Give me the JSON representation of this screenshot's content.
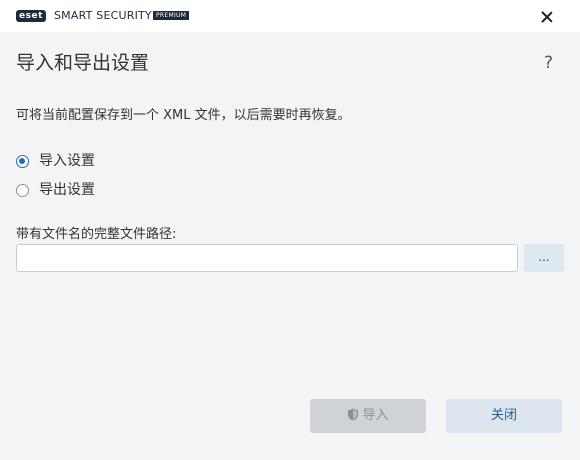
{
  "titlebar": {
    "logo": "eset",
    "product": "SMART SECURITY",
    "edition": "PREMIUM"
  },
  "dialog": {
    "title": "导入和导出设置",
    "help": "?",
    "description": "可将当前配置保存到一个 XML 文件，以后需要时再恢复。"
  },
  "options": [
    {
      "label": "导入设置",
      "selected": true
    },
    {
      "label": "导出设置",
      "selected": false
    }
  ],
  "path": {
    "label": "带有文件名的完整文件路径:",
    "value": "",
    "browse_label": "..."
  },
  "buttons": {
    "import_label": "导入",
    "close_label": "关闭"
  },
  "icons": {
    "close": "close-icon",
    "help": "help-icon",
    "shield": "shield-icon"
  },
  "colors": {
    "accent": "#1f6fb5",
    "background": "#f3f4f6",
    "disabled_button": "#cfd2d6",
    "secondary_button": "#dde6ef"
  }
}
